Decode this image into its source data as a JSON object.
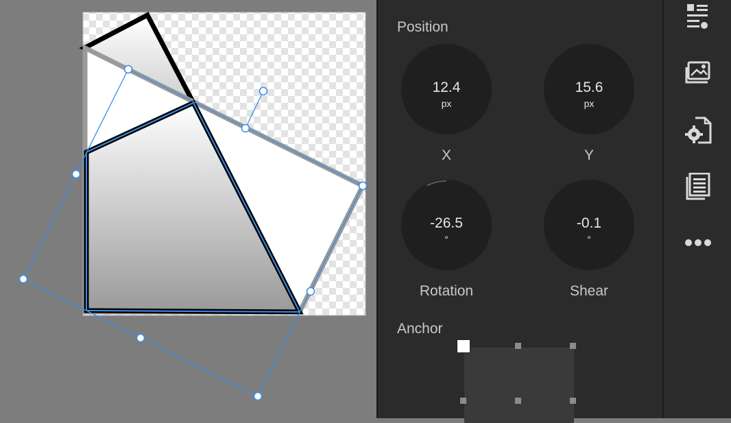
{
  "position": {
    "title": "Position",
    "x": {
      "value": "12.4",
      "unit": "px",
      "label": "X"
    },
    "y": {
      "value": "15.6",
      "unit": "px",
      "label": "Y"
    }
  },
  "transform": {
    "rotation": {
      "value": "-26.5",
      "unit": "°",
      "label": "Rotation"
    },
    "shear": {
      "value": "-0.1",
      "unit": "°",
      "label": "Shear"
    }
  },
  "anchor": {
    "title": "Anchor",
    "selected": "top-left"
  },
  "toolbar": {
    "icons": [
      "properties-icon",
      "image-layers-icon",
      "document-settings-icon",
      "document-pages-icon",
      "more-icon"
    ]
  },
  "colors": {
    "selection": "#3d8ee6",
    "panel_bg": "#2b2b2b",
    "canvas_bg": "#7d7d7d"
  }
}
